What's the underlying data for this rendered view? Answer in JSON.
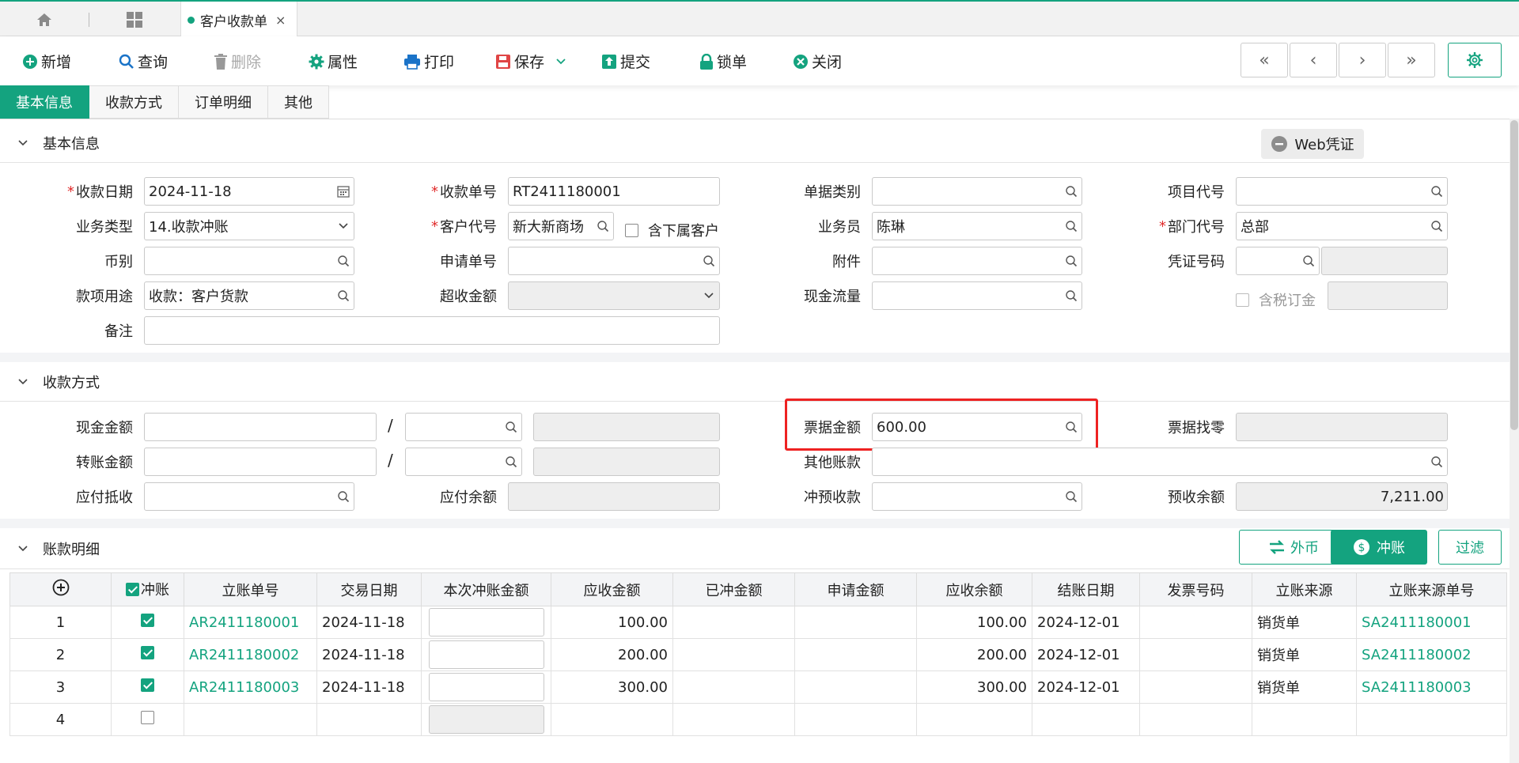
{
  "topbar": {
    "home_icon": "home-icon",
    "grid_icon": "apps-grid-icon",
    "tab_label": "客户收款单",
    "tab_close": "×"
  },
  "toolbar": {
    "new": "新增",
    "query": "查询",
    "delete": "删除",
    "properties": "属性",
    "print": "打印",
    "save": "保存",
    "submit": "提交",
    "lock": "锁单",
    "close": "关闭",
    "nav_first": "«",
    "nav_prev": "‹",
    "nav_next": "›",
    "nav_last": "»"
  },
  "form_tabs": [
    "基本信息",
    "收款方式",
    "订单明细",
    "其他"
  ],
  "sections": {
    "basic": "基本信息",
    "payment": "收款方式",
    "detail": "账款明细"
  },
  "web_voucher": "Web凭证",
  "basic": {
    "receipt_date_label": "收款日期",
    "receipt_date": "2024-11-18",
    "receipt_no_label": "收款单号",
    "receipt_no": "RT2411180001",
    "doc_category_label": "单据类别",
    "doc_category": "",
    "project_code_label": "项目代号",
    "project_code": "",
    "biz_type_label": "业务类型",
    "biz_type": "14.收款冲账",
    "customer_code_label": "客户代号",
    "customer_code": "新大新商场",
    "include_sub_label": "含下属客户",
    "salesperson_label": "业务员",
    "salesperson": "陈琳",
    "dept_code_label": "部门代号",
    "dept_code": "总部",
    "currency_label": "币别",
    "currency": "",
    "apply_no_label": "申请单号",
    "apply_no": "",
    "attachment_label": "附件",
    "attachment": "",
    "voucher_no_label": "凭证号码",
    "voucher_no": "",
    "purpose_label": "款项用途",
    "purpose": "收款：客户货款",
    "over_amount_label": "超收金额",
    "over_amount": "",
    "cash_flow_label": "现金流量",
    "cash_flow": "",
    "tax_deposit_label": "含税订金",
    "remark_label": "备注",
    "remark": ""
  },
  "payment": {
    "cash_amount_label": "现金金额",
    "bill_amount_label": "票据金额",
    "bill_amount": "600.00",
    "bill_change_label": "票据找零",
    "transfer_amount_label": "转账金额",
    "other_account_label": "其他账款",
    "payable_offset_label": "应付抵收",
    "payable_balance_label": "应付余额",
    "prepay_offset_label": "冲预收款",
    "prepay_balance_label": "预收余额",
    "prepay_balance": "7,211.00",
    "slash": "/"
  },
  "detail_buttons": {
    "foreign": "外币",
    "offset": "冲账",
    "filter": "过滤"
  },
  "grid": {
    "headers": [
      "冲账",
      "立账单号",
      "交易日期",
      "本次冲账金额",
      "应收金额",
      "已冲金额",
      "申请金额",
      "应收余额",
      "结账日期",
      "发票号码",
      "立账来源",
      "立账来源单号"
    ],
    "rows": [
      {
        "no": "1",
        "checked": true,
        "ar_no": "AR2411180001",
        "date": "2024-11-18",
        "receivable": "100.00",
        "balance": "100.00",
        "settle_date": "2024-12-01",
        "source": "销货单",
        "source_no": "SA2411180001"
      },
      {
        "no": "2",
        "checked": true,
        "ar_no": "AR2411180002",
        "date": "2024-11-18",
        "receivable": "200.00",
        "balance": "200.00",
        "settle_date": "2024-12-01",
        "source": "销货单",
        "source_no": "SA2411180002"
      },
      {
        "no": "3",
        "checked": true,
        "ar_no": "AR2411180003",
        "date": "2024-11-18",
        "receivable": "300.00",
        "balance": "300.00",
        "settle_date": "2024-12-01",
        "source": "销货单",
        "source_no": "SA2411180003"
      },
      {
        "no": "4",
        "checked": false,
        "ar_no": "",
        "date": "",
        "receivable": "",
        "balance": "",
        "settle_date": "",
        "source": "",
        "source_no": ""
      }
    ]
  },
  "colors": {
    "accent": "#14a37f",
    "required": "#e02b2b",
    "highlight": "#ee2222"
  }
}
